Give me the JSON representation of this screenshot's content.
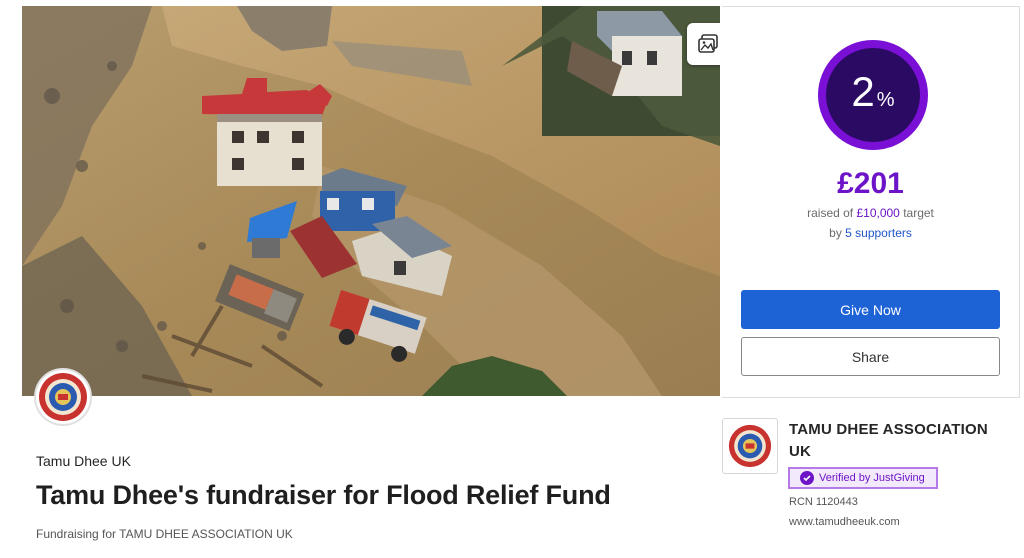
{
  "hero": {
    "gallery_icon": "image-gallery-icon"
  },
  "progress": {
    "percent_value": "2",
    "percent_sign": "%",
    "fraction": 0.02
  },
  "funding": {
    "raised": "£201",
    "raised_prefix": "raised of ",
    "target": "£10,000",
    "target_suffix": " target",
    "by_prefix": "by ",
    "supporters": "5 supporters"
  },
  "actions": {
    "give_label": "Give Now",
    "share_label": "Share"
  },
  "fundraiser": {
    "organizer": "Tamu Dhee UK",
    "title": "Tamu Dhee's fundraiser for Flood Relief Fund",
    "fundraising_for": "Fundraising for TAMU DHEE ASSOCIATION UK"
  },
  "charity": {
    "name": "TAMU DHEE ASSOCIATION UK",
    "verified": "Verified by JustGiving",
    "rcn": "RCN 1120443",
    "website": "www.tamudheeuk.com"
  },
  "colors": {
    "accent_purple": "#6d14c8",
    "ring_dark": "#2b0a63",
    "give_button_blue": "#1e63d6"
  }
}
